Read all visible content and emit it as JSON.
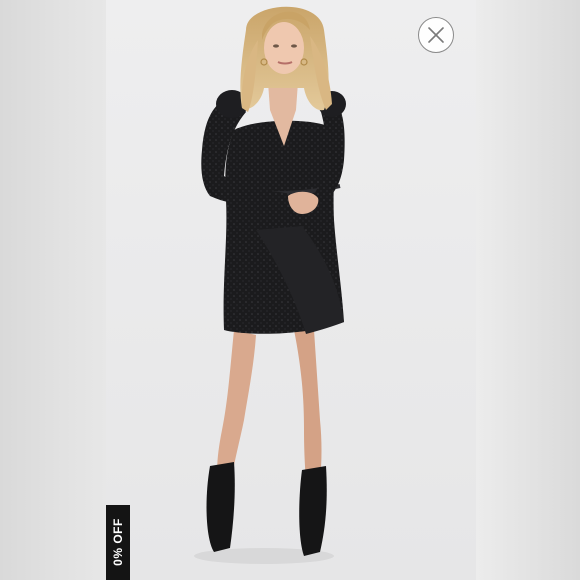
{
  "listing_viewer": {
    "discount_badge": "0% OFF",
    "close_icon": "close-icon",
    "photo_subject": "model-wearing-black-wrap-mini-dress-icon"
  },
  "colors": {
    "badge_background": "#141414",
    "badge_text": "#ffffff",
    "close_border": "#8a8a8a",
    "photo_background": "#e9e9ea"
  }
}
